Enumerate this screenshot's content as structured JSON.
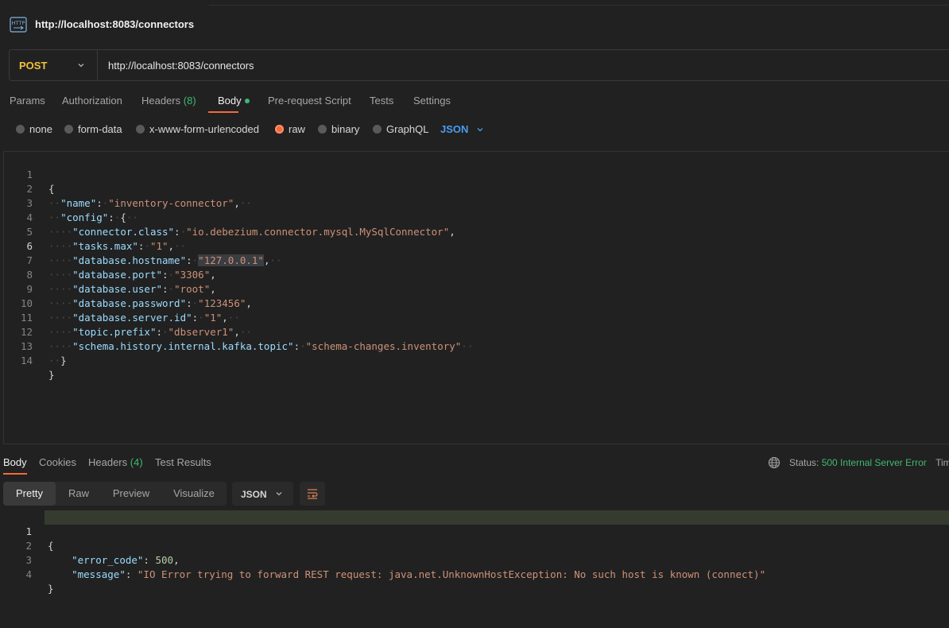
{
  "title": "http://localhost:8083/connectors",
  "request": {
    "method": "POST",
    "url": "http://localhost:8083/connectors"
  },
  "request_tabs": {
    "params": "Params",
    "authorization": "Authorization",
    "headers": "Headers",
    "headers_count": "(8)",
    "body": "Body",
    "pre_request": "Pre-request Script",
    "tests": "Tests",
    "settings": "Settings"
  },
  "body_types": {
    "none": "none",
    "form_data": "form-data",
    "urlencoded": "x-www-form-urlencoded",
    "raw": "raw",
    "binary": "binary",
    "graphql": "GraphQL",
    "selected": "raw",
    "language": "JSON"
  },
  "editor": {
    "line_numbers": [
      "1",
      "2",
      "3",
      "4",
      "5",
      "6",
      "7",
      "8",
      "9",
      "10",
      "11",
      "12",
      "13",
      "14"
    ],
    "keys": {
      "name": "\"name\"",
      "config": "\"config\"",
      "connector_class": "\"connector.class\"",
      "tasks_max": "\"tasks.max\"",
      "db_hostname": "\"database.hostname\"",
      "db_port": "\"database.port\"",
      "db_user": "\"database.user\"",
      "db_password": "\"database.password\"",
      "db_server_id": "\"database.server.id\"",
      "topic_prefix": "\"topic.prefix\"",
      "schema_topic": "\"schema.history.internal.kafka.topic\""
    },
    "values": {
      "name": "\"inventory-connector\"",
      "connector_class": "\"io.debezium.connector.mysql.MySqlConnector\"",
      "tasks_max": "\"1\"",
      "db_hostname": "\"127.0.0.1\"",
      "db_port": "\"3306\"",
      "db_user": "\"root\"",
      "db_password": "\"123456\"",
      "db_server_id": "\"1\"",
      "topic_prefix": "\"dbserver1\"",
      "schema_topic": "\"schema-changes.inventory\""
    }
  },
  "response_tabs": {
    "body": "Body",
    "cookies": "Cookies",
    "headers": "Headers",
    "headers_count": "(4)",
    "test_results": "Test Results"
  },
  "status": {
    "label": "Status:",
    "value": "500 Internal Server Error",
    "time_label": "Tim"
  },
  "view_modes": {
    "pretty": "Pretty",
    "raw": "Raw",
    "preview": "Preview",
    "visualize": "Visualize",
    "format": "JSON"
  },
  "response": {
    "line_numbers": [
      "1",
      "2",
      "3",
      "4"
    ],
    "error_code_key": "\"error_code\"",
    "error_code_value": "500",
    "message_key": "\"message\"",
    "message_value": "\"IO Error trying to forward REST request: java.net.UnknownHostException: No such host is known (connect)\""
  },
  "colors": {
    "accent": "#f26b3a",
    "method": "#f3c13a",
    "success": "#3fb971",
    "link": "#4a9cf0"
  }
}
